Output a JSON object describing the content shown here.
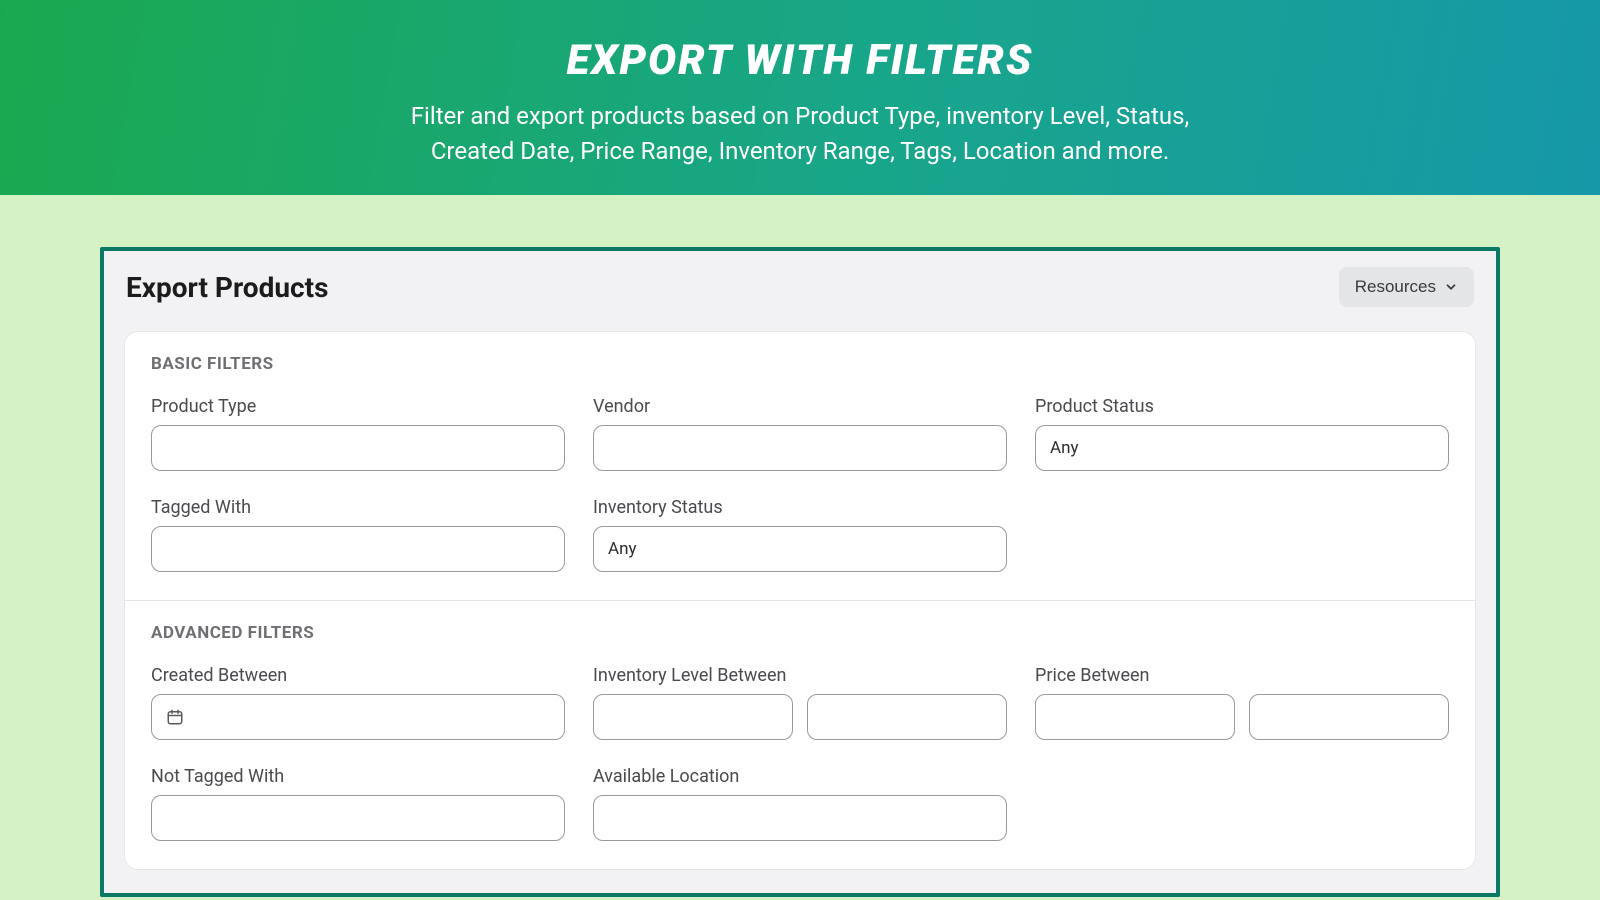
{
  "hero": {
    "title": "EXPORT WITH FILTERS",
    "subtitle_line1": "Filter and export products based on Product Type, inventory Level, Status,",
    "subtitle_line2": "Created Date, Price Range, Inventory Range, Tags, Location and more."
  },
  "panel": {
    "title": "Export Products",
    "resources_label": "Resources"
  },
  "basic": {
    "section_title": "BASIC FILTERS",
    "product_type": {
      "label": "Product Type",
      "value": ""
    },
    "vendor": {
      "label": "Vendor",
      "value": ""
    },
    "product_status": {
      "label": "Product Status",
      "value": "Any"
    },
    "tagged_with": {
      "label": "Tagged With",
      "value": ""
    },
    "inventory_status": {
      "label": "Inventory Status",
      "value": "Any"
    }
  },
  "advanced": {
    "section_title": "ADVANCED FILTERS",
    "created_between": {
      "label": "Created Between",
      "value": ""
    },
    "inventory_level_between": {
      "label": "Inventory Level Between",
      "from": "",
      "to": ""
    },
    "price_between": {
      "label": "Price Between",
      "from": "",
      "to": ""
    },
    "not_tagged_with": {
      "label": "Not Tagged With",
      "value": ""
    },
    "available_location": {
      "label": "Available Location",
      "value": ""
    }
  }
}
